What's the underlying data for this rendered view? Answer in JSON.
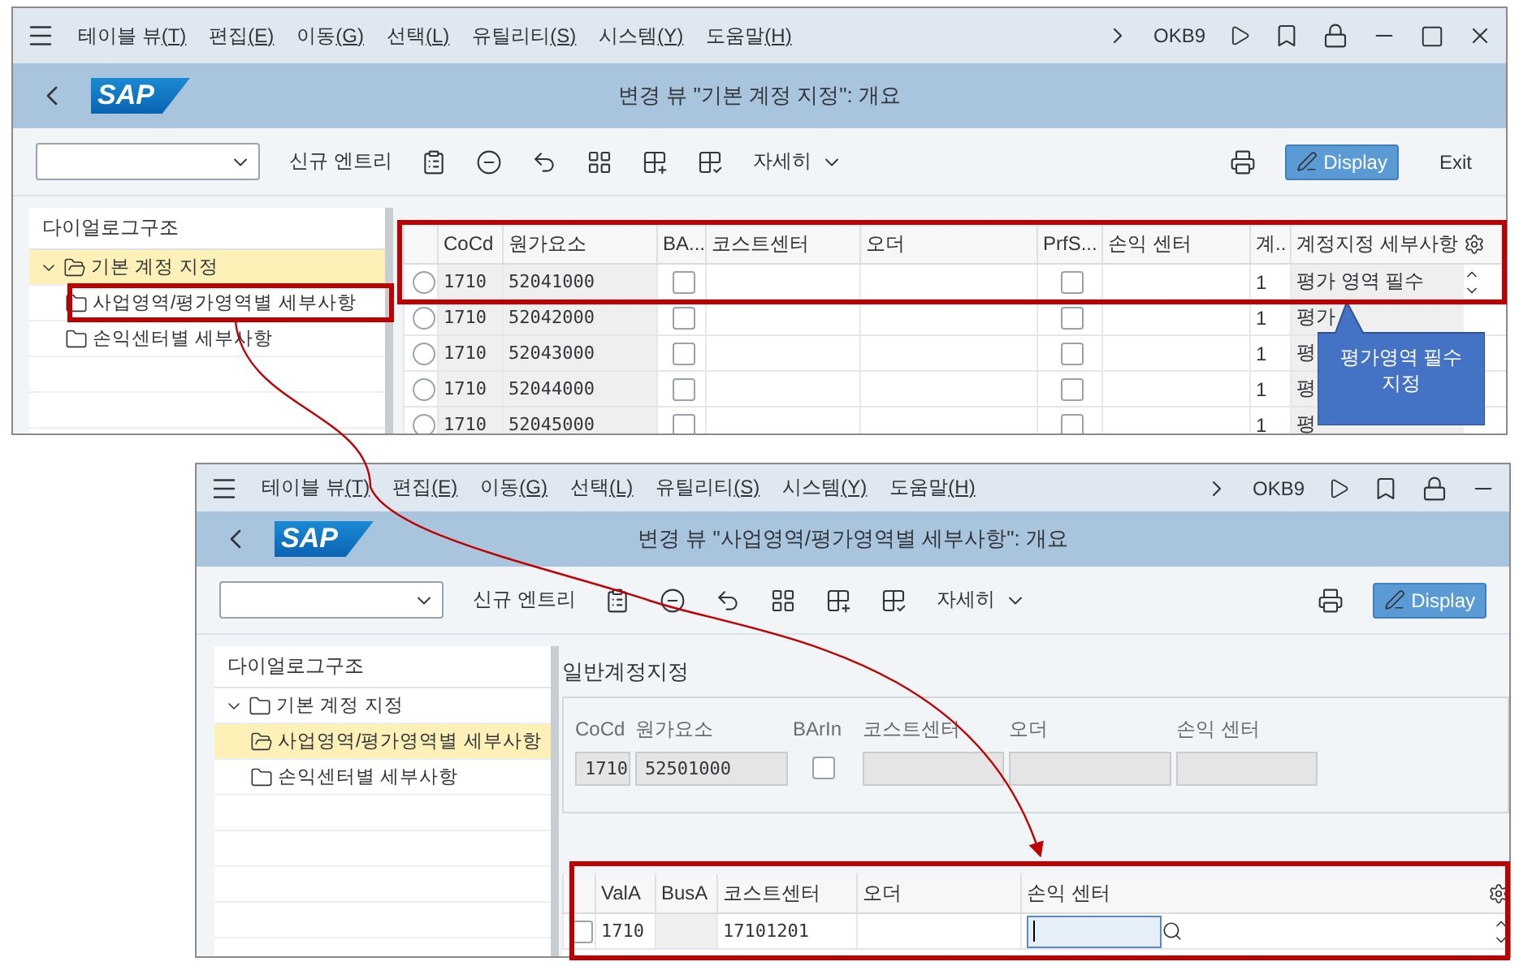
{
  "main_window": {
    "menu": [
      {
        "label": "테이블 뷰",
        "mnemonic": "(T)"
      },
      {
        "label": "편집",
        "mnemonic": "(E)"
      },
      {
        "label": "이동",
        "mnemonic": "(G)"
      },
      {
        "label": "선택",
        "mnemonic": "(L)"
      },
      {
        "label": "유틸리티",
        "mnemonic": "(S)"
      },
      {
        "label": "시스템",
        "mnemonic": "(Y)"
      },
      {
        "label": "도움말",
        "mnemonic": "(H)"
      }
    ],
    "tcode": "OKB9",
    "logo": "SAP",
    "title": "변경 뷰 \"기본 계정 지정\": 개요",
    "toolbar": {
      "new_entry": "신규 엔트리",
      "more": "자세히",
      "buttons": [
        {
          "label": "Display",
          "kind": "primary"
        },
        {
          "label": "Exit",
          "kind": "plain"
        }
      ]
    },
    "tree": {
      "header": "다이얼로그구조",
      "items": [
        {
          "label": "기본 계정 지정",
          "selected": true,
          "expanded": true,
          "children": [
            {
              "label": "사업영역/평가영역별 세부사항",
              "selected": false
            },
            {
              "label": "손익센터별 세부사항",
              "selected": false
            }
          ]
        }
      ]
    },
    "table": {
      "columns": [
        "CoCd",
        "원가요소",
        "BA...",
        "코스트센터",
        "오더",
        "PrfS...",
        "손익 센터",
        "계..",
        "계정지정 세부사항"
      ],
      "rows": [
        {
          "selected": false,
          "cocd": "1710",
          "cost_element": "52041000",
          "ba_checked": false,
          "prfs_checked": false,
          "account": "1",
          "detail": "평가 영역 필수"
        },
        {
          "selected": false,
          "cocd": "1710",
          "cost_element": "52042000",
          "ba_checked": false,
          "prfs_checked": false,
          "account": "1",
          "detail": "평가"
        },
        {
          "selected": false,
          "cocd": "1710",
          "cost_element": "52043000",
          "ba_checked": false,
          "prfs_checked": false,
          "account": "1",
          "detail": "평"
        },
        {
          "selected": false,
          "cocd": "1710",
          "cost_element": "52044000",
          "ba_checked": false,
          "prfs_checked": false,
          "account": "1",
          "detail": "평"
        },
        {
          "selected": false,
          "cocd": "1710",
          "cost_element": "52045000",
          "ba_checked": false,
          "prfs_checked": false,
          "account": "1",
          "detail": "평"
        }
      ]
    }
  },
  "callout": "평가영역 필수 지정",
  "detail_window": {
    "menu": [
      {
        "label": "테이블 뷰",
        "mnemonic": "(T)"
      },
      {
        "label": "편집",
        "mnemonic": "(E)"
      },
      {
        "label": "이동",
        "mnemonic": "(G)"
      },
      {
        "label": "선택",
        "mnemonic": "(L)"
      },
      {
        "label": "유틸리티",
        "mnemonic": "(S)"
      },
      {
        "label": "시스템",
        "mnemonic": "(Y)"
      },
      {
        "label": "도움말",
        "mnemonic": "(H)"
      }
    ],
    "tcode": "OKB9",
    "logo": "SAP",
    "title": "변경 뷰 \"사업영역/평가영역별 세부사항\": 개요",
    "toolbar": {
      "new_entry": "신규 엔트리",
      "more": "자세히",
      "buttons": [
        {
          "label": "Display",
          "kind": "primary"
        }
      ]
    },
    "tree": {
      "header": "다이얼로그구조",
      "items": [
        {
          "label": "기본 계정 지정",
          "selected": false,
          "expanded": true,
          "children": [
            {
              "label": "사업영역/평가영역별 세부사항",
              "selected": true
            },
            {
              "label": "손익센터별 세부사항",
              "selected": false
            }
          ]
        }
      ]
    },
    "section": {
      "title": "일반계정지정",
      "labels": [
        "CoCd",
        "원가요소",
        "BArIn",
        "코스트센터",
        "오더",
        "손익 센터"
      ],
      "cocd": "1710",
      "cost_element": "52501000",
      "barin_checked": false
    },
    "table": {
      "columns": [
        "ValA",
        "BusA",
        "코스트센터",
        "오더",
        "손익 센터"
      ],
      "rows": [
        {
          "selected": false,
          "vala": "1710",
          "cost_center": "17101201",
          "profit_center_focused": true
        }
      ]
    }
  }
}
